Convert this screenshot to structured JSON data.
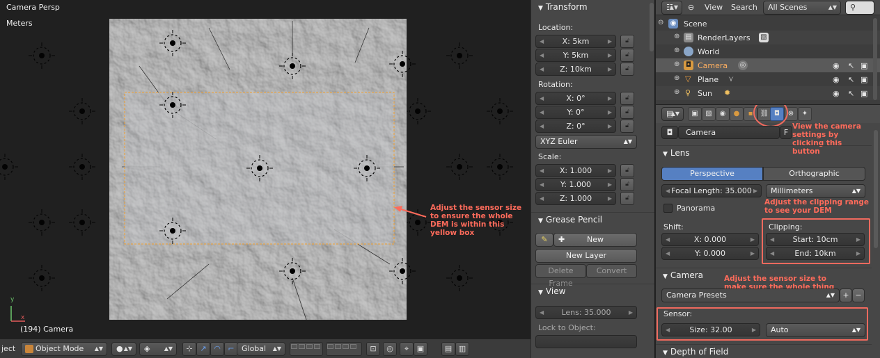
{
  "viewport": {
    "view_label": "Camera Persp",
    "units_label": "Meters",
    "object_label": "(194) Camera",
    "axis_x": "x",
    "axis_y": "y",
    "annotation": "Adjust the sensor size to ensure the whole DEM is within this yellow box",
    "colors": {
      "frame": "#f0a030",
      "annotation": "#ff6b5b"
    }
  },
  "viewport_header": {
    "editor_label": "ject",
    "mode": "Object Mode",
    "orientation": "Global"
  },
  "npanel": {
    "transform": {
      "title": "Transform",
      "location_label": "Location:",
      "location": [
        "X: 5km",
        "Y: 5km",
        "Z: 10km"
      ],
      "rotation_label": "Rotation:",
      "rotation": [
        "X: 0°",
        "Y: 0°",
        "Z: 0°"
      ],
      "rotation_mode": "XYZ Euler",
      "scale_label": "Scale:",
      "scale": [
        "X: 1.000",
        "Y: 1.000",
        "Z: 1.000"
      ]
    },
    "grease_pencil": {
      "title": "Grease Pencil",
      "new_label": "New",
      "new_layer_label": "New Layer",
      "delete_frame_label": "Delete Frame",
      "convert_label": "Convert"
    },
    "view": {
      "title": "View",
      "lens": "Lens: 35.000",
      "lock_label": "Lock to Object:"
    }
  },
  "outliner": {
    "view_label": "View",
    "search_label": "Search",
    "scene_filter": "All Scenes",
    "items": [
      {
        "label": "Scene"
      },
      {
        "label": "RenderLayers"
      },
      {
        "label": "World"
      },
      {
        "label": "Camera"
      },
      {
        "label": "Plane"
      },
      {
        "label": "Sun"
      }
    ]
  },
  "properties": {
    "camera_name": "Camera",
    "fake_user": "F",
    "annotation_tab": "View the camera settings by clicking this button",
    "lens": {
      "title": "Lens",
      "perspective_label": "Perspective",
      "orthographic_label": "Orthographic",
      "focal_length": "Focal Length: 35.000",
      "units": "Millimeters",
      "panorama_label": "Panorama",
      "shift_label": "Shift:",
      "shift_x": "X: 0.000",
      "shift_y": "Y: 0.000",
      "clipping_label": "Clipping:",
      "clip_start": "Start: 10cm",
      "clip_end": "End: 10km",
      "annotation_clip": "Adjust the clipping range to see your DEM"
    },
    "camera": {
      "title": "Camera",
      "presets_label": "Camera Presets",
      "sensor_label": "Sensor:",
      "sensor_size": "Size: 32.00",
      "sensor_fit": "Auto",
      "annotation_sensor": "Adjust the sensor size to make sure the whole thing is in view"
    },
    "dof_title": "Depth of Field"
  }
}
